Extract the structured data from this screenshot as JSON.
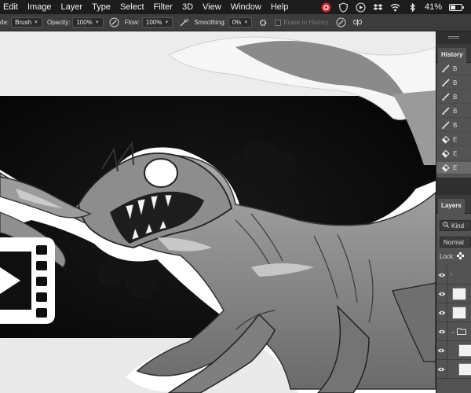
{
  "menu_bar": {
    "items": [
      "Edit",
      "Image",
      "Layer",
      "Type",
      "Select",
      "Filter",
      "3D",
      "View",
      "Window",
      "Help"
    ],
    "battery_percent": "41%",
    "icons": [
      "creative-cloud-icon",
      "shield-icon",
      "play-icon",
      "dropbox-icon",
      "wifi-icon",
      "bluetooth-icon",
      "battery-icon"
    ]
  },
  "options_bar": {
    "mode_label": "de:",
    "mode_value": "Brush",
    "opacity_label": "Opacity:",
    "opacity_value": "100%",
    "flow_label": "Flow:",
    "flow_value": "100%",
    "smoothing_label": "Smoothing:",
    "smoothing_value": "0%",
    "erase_to_history_label": "Erase to History"
  },
  "history_panel": {
    "tab_label": "History",
    "rows": [
      {
        "icon": "brush-icon",
        "label": "B",
        "selected": false
      },
      {
        "icon": "brush-icon",
        "label": "B",
        "selected": false
      },
      {
        "icon": "brush-icon",
        "label": "B",
        "selected": false
      },
      {
        "icon": "brush-icon",
        "label": "B",
        "selected": false
      },
      {
        "icon": "brush-icon",
        "label": "B",
        "selected": false
      },
      {
        "icon": "eraser-icon",
        "label": "E",
        "selected": false
      },
      {
        "icon": "eraser-icon",
        "label": "E",
        "selected": false
      },
      {
        "icon": "eraser-icon",
        "label": "E",
        "selected": true
      }
    ]
  },
  "layers_panel": {
    "tab_label": "Layers",
    "filter_placeholder": "Kind",
    "blend_mode": "Normal",
    "lock_label": "Lock:"
  },
  "colors": {
    "menu_bar": "#1c1c1c",
    "options_bar": "#3c3c3c",
    "panel": "#535353",
    "canvas_background": "#ececec",
    "creature_gray": "#7d7d7d",
    "artwork_backdrop": "#080808"
  },
  "overlay": {
    "icon": "film-play-icon"
  }
}
